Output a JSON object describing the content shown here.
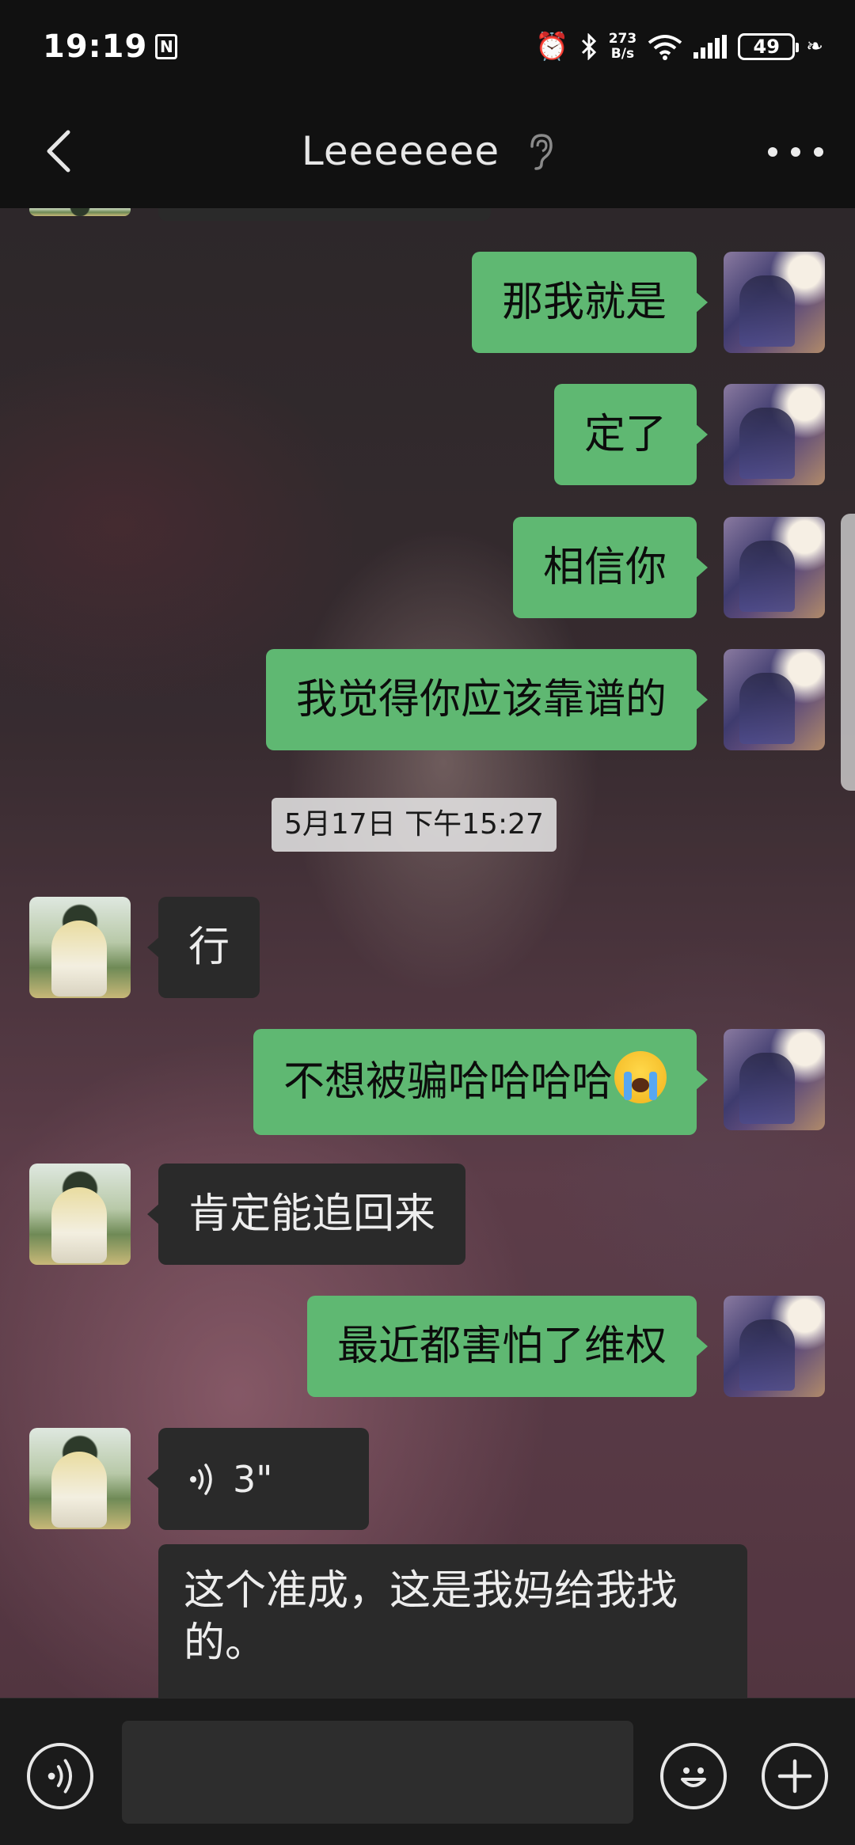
{
  "status_bar": {
    "time": "19:19",
    "nfc_label": "N",
    "net_speed_value": "273",
    "net_speed_unit": "B/s",
    "battery": "49"
  },
  "header": {
    "title": "Leeeeeee"
  },
  "messages": [
    {
      "sender": "me",
      "text": "那我就是"
    },
    {
      "sender": "me",
      "text": "定了"
    },
    {
      "sender": "me",
      "text": "相信你"
    },
    {
      "sender": "me",
      "text": "我觉得你应该靠谱的"
    },
    {
      "type": "timestamp",
      "text": "5月17日 下午15:27"
    },
    {
      "sender": "other",
      "text": "行"
    },
    {
      "sender": "me",
      "text": "不想被骗哈哈哈哈",
      "emoji": "loudly-crying-face"
    },
    {
      "sender": "other",
      "text": "肯定能追回来"
    },
    {
      "sender": "me",
      "text": "最近都害怕了维权"
    },
    {
      "sender": "other",
      "type": "voice",
      "duration": "3\""
    },
    {
      "sender": "other",
      "text": "这个准成，这是我妈给我找的。"
    }
  ],
  "input_bar": {
    "placeholder": ""
  },
  "colors": {
    "bubble_me": "#5fb872",
    "bubble_other": "#2a2a2a",
    "bar_background": "#111111"
  }
}
